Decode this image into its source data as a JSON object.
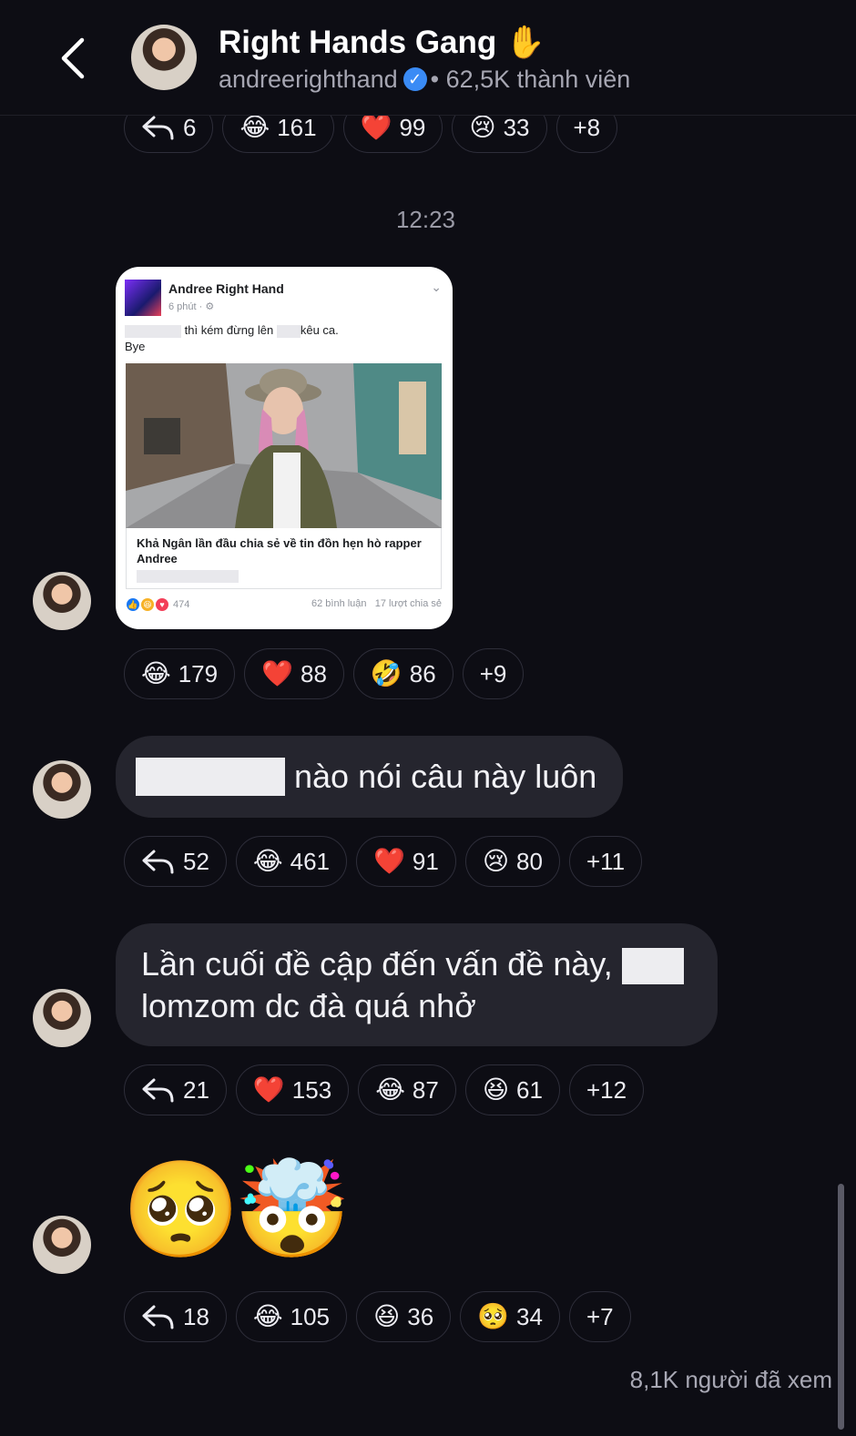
{
  "header": {
    "title": "Right Hands Gang",
    "title_emoji": "✋",
    "username": "andreerighthand",
    "members": "• 62,5K thành viên"
  },
  "reactions_top": [
    {
      "type": "reply",
      "count": "6"
    },
    {
      "emoji": "😂",
      "count": "161"
    },
    {
      "emoji": "❤️",
      "count": "99"
    },
    {
      "emoji": "😢",
      "count": "33"
    },
    {
      "more": "+8"
    }
  ],
  "timestamp": "12:23",
  "shared_post": {
    "page_name": "Andree Right Hand",
    "time": "6 phút · ⚙",
    "text_part1": "thì kém đừng lên",
    "text_part2": "kêu ca.",
    "text_line2": "Bye",
    "link_title": "Khả Ngân lần đầu chia sẻ về tin đồn hẹn hò rapper Andree",
    "reaction_count": "474",
    "comments": "62 bình luận",
    "shares": "17 lượt chia sẻ"
  },
  "reactions_post": [
    {
      "emoji": "😂",
      "count": "179"
    },
    {
      "emoji": "❤️",
      "count": "88"
    },
    {
      "emoji": "🤣",
      "count": "86"
    },
    {
      "more": "+9"
    }
  ],
  "message1": {
    "text": "nào nói câu này luôn"
  },
  "reactions_msg1": [
    {
      "type": "reply",
      "count": "52"
    },
    {
      "emoji": "😂",
      "count": "461"
    },
    {
      "emoji": "❤️",
      "count": "91"
    },
    {
      "emoji": "😢",
      "count": "80"
    },
    {
      "more": "+11"
    }
  ],
  "message2": {
    "line1": "Lần cuối đề cập đến vấn đề này,",
    "line2": "lomzom dc đà quá nhở"
  },
  "reactions_msg2": [
    {
      "type": "reply",
      "count": "21"
    },
    {
      "emoji": "❤️",
      "count": "153"
    },
    {
      "emoji": "😂",
      "count": "87"
    },
    {
      "emoji": "😆",
      "count": "61"
    },
    {
      "more": "+12"
    }
  ],
  "message3": {
    "emoji1": "🥺",
    "emoji2": "🤯"
  },
  "reactions_msg3": [
    {
      "type": "reply",
      "count": "18"
    },
    {
      "emoji": "😂",
      "count": "105"
    },
    {
      "emoji": "😆",
      "count": "36"
    },
    {
      "emoji": "🥺",
      "count": "34"
    },
    {
      "more": "+7"
    }
  ],
  "seen_count": "8,1K người đã xem",
  "colors": {
    "background": "#0d0d14",
    "bubble": "#25252e",
    "verified": "#3a8bf5"
  }
}
